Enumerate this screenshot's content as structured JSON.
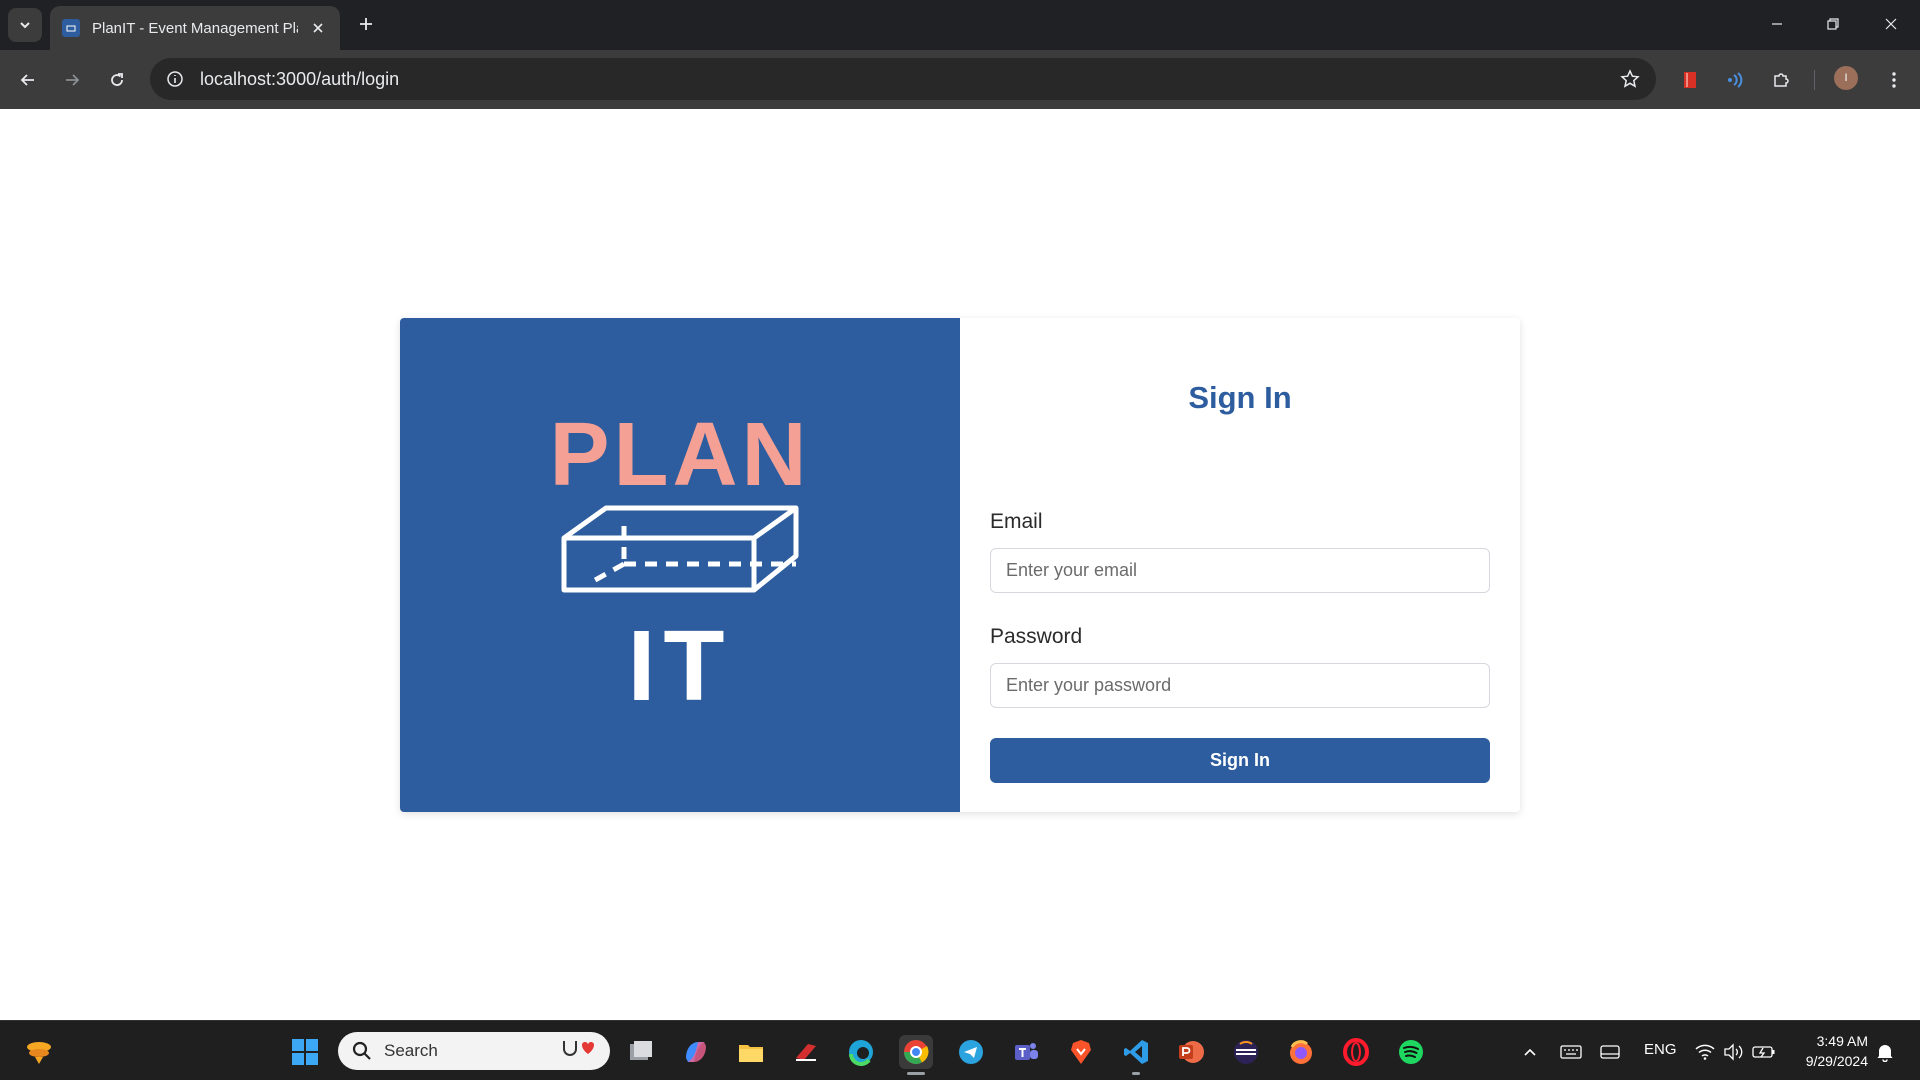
{
  "browser": {
    "tab_title": "PlanIT - Event Management Platform",
    "url": "localhost:3000/auth/login",
    "profile_initial": "I"
  },
  "page": {
    "logo_top": "PLAN",
    "logo_bottom": "IT",
    "form_title": "Sign In",
    "email_label": "Email",
    "email_placeholder": "Enter your email",
    "password_label": "Password",
    "password_placeholder": "Enter your password",
    "submit_label": "Sign In"
  },
  "taskbar": {
    "search_placeholder": "Search",
    "language": "ENG",
    "time": "3:49 AM",
    "date": "9/29/2024"
  },
  "colors": {
    "brand_blue": "#2d5d9e",
    "logo_coral": "#f5a094"
  }
}
